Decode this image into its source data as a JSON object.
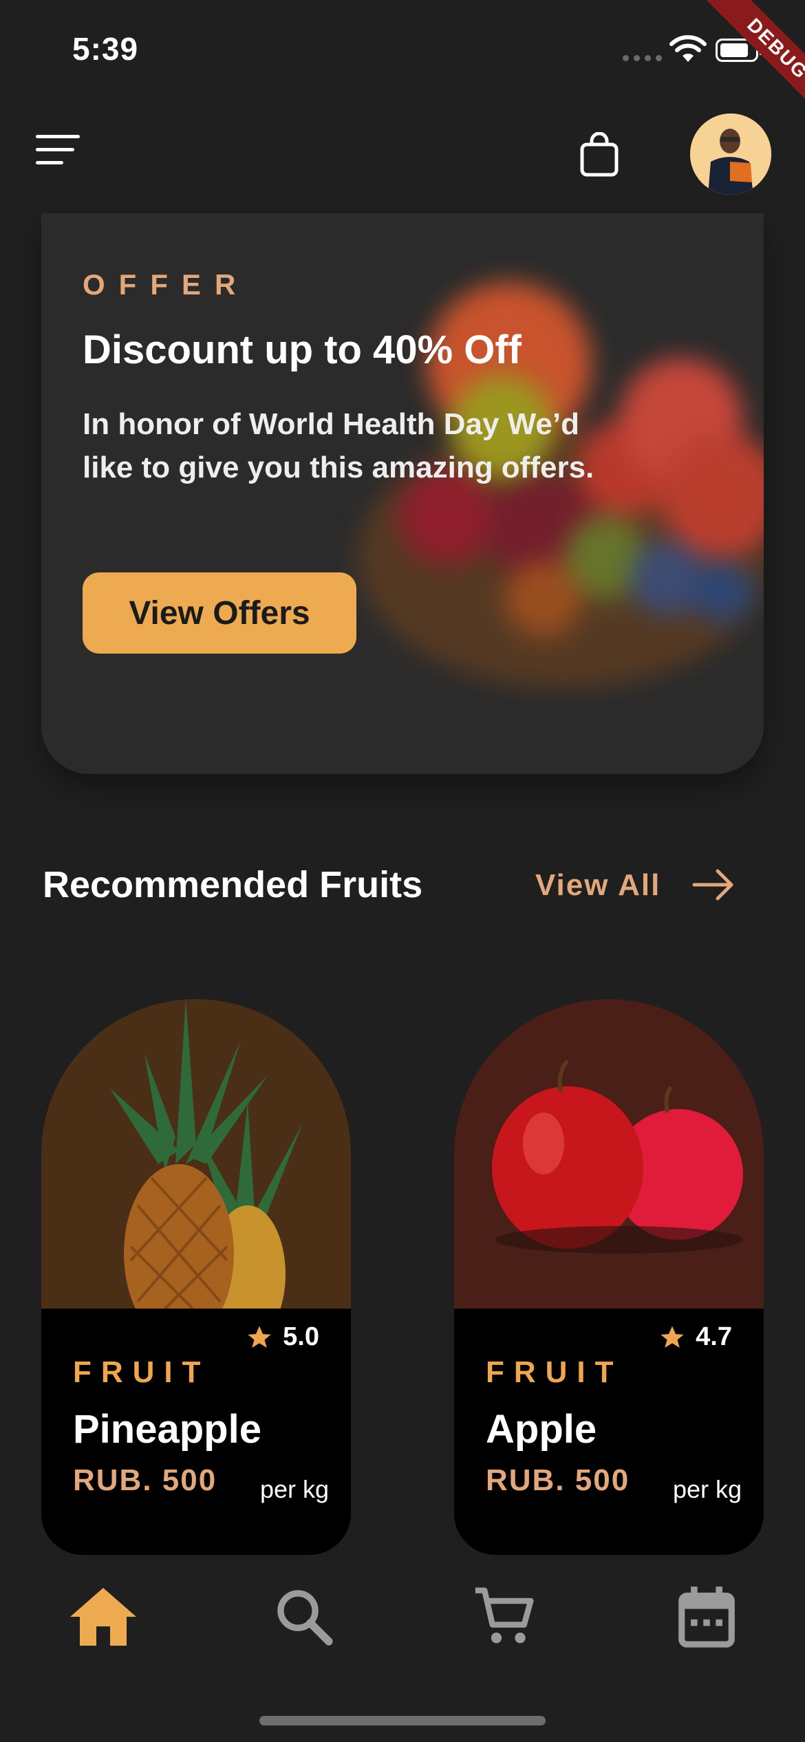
{
  "status_bar": {
    "time": "5:39",
    "debug_label": "DEBUG"
  },
  "header": {
    "menu_icon": "menu-icon",
    "bag_icon": "shopping-bag-icon",
    "avatar_icon": "avatar"
  },
  "offer": {
    "label": "OFFER",
    "title": "Discount up to 40% Off",
    "description": "In honor of World Health Day We’d like to give you this amazing offers.",
    "button_label": "View Offers"
  },
  "recommended": {
    "title": "Recommended Fruits",
    "view_all_label": "View All",
    "items": [
      {
        "category": "FRUIT",
        "name": "Pineapple",
        "rating": "5.0",
        "price": "RUB. 500",
        "unit": "per kg",
        "bg_color": "#4a2f16"
      },
      {
        "category": "FRUIT",
        "name": "Apple",
        "rating": "4.7",
        "price": "RUB. 500",
        "unit": "per kg",
        "bg_color": "#4a1f18"
      }
    ]
  },
  "bottom_nav": [
    {
      "icon": "home-icon",
      "active": true
    },
    {
      "icon": "search-icon",
      "active": false
    },
    {
      "icon": "cart-icon",
      "active": false
    },
    {
      "icon": "calendar-icon",
      "active": false
    }
  ],
  "colors": {
    "accent": "#edaa50",
    "offer_text": "#e2a77b",
    "background": "#1f1f1f",
    "card": "#2b2b2b",
    "inactive_icon": "#9b9b9b"
  }
}
